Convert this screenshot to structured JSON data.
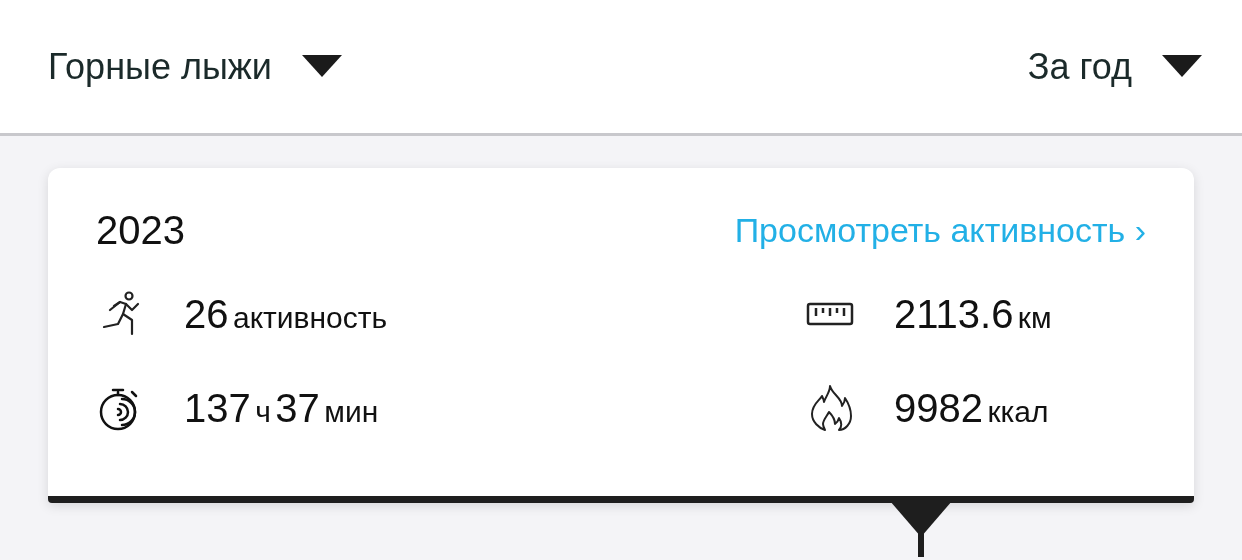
{
  "filters": [
    {
      "label": "Горные лыжи"
    },
    {
      "label": "За год"
    }
  ],
  "summary": {
    "year": "2023",
    "link": "Просмотреть активность ›",
    "stats": [
      {
        "kind": "runner",
        "parts": [
          {
            "text": "26",
            "kind": "number"
          },
          {
            "text": "активность",
            "kind": "unit"
          }
        ]
      },
      {
        "kind": "ruler",
        "parts": [
          {
            "text": "2113.6",
            "kind": "number"
          },
          {
            "text": "км",
            "kind": "unit"
          }
        ]
      },
      {
        "kind": "stopwatch",
        "parts": [
          {
            "text": "137",
            "kind": "number"
          },
          {
            "text": "ч",
            "kind": "unit"
          },
          {
            "text": "37",
            "kind": "number"
          },
          {
            "text": "мин",
            "kind": "unit"
          }
        ]
      },
      {
        "kind": "flame",
        "parts": [
          {
            "text": "9982",
            "kind": "number"
          },
          {
            "text": "ккал",
            "kind": "unit"
          }
        ]
      }
    ]
  }
}
